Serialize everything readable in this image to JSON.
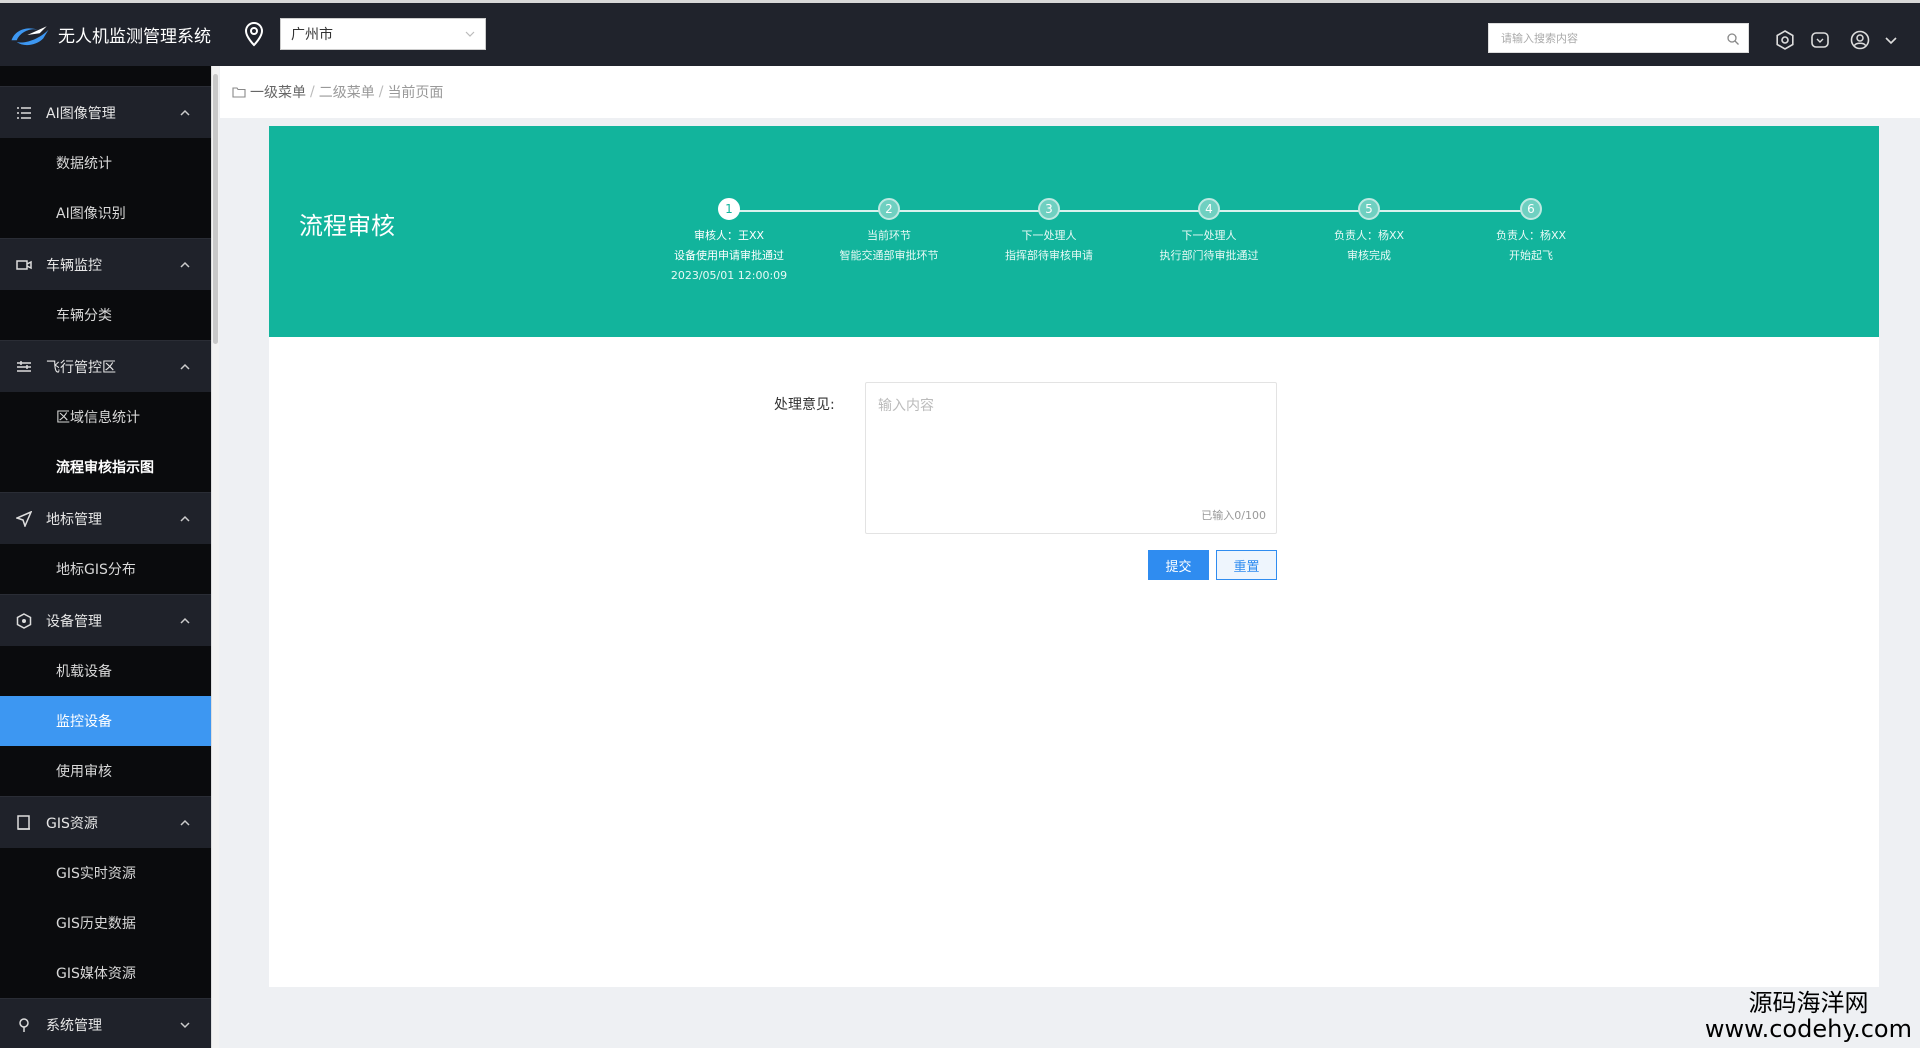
{
  "app": {
    "title": "无人机监测管理系统"
  },
  "header": {
    "city": "广州市",
    "search_placeholder": "请输入搜索内容",
    "icons": [
      "settings-icon",
      "message-icon",
      "user-icon",
      "chevron-down-icon"
    ]
  },
  "sidebar": {
    "groups": [
      {
        "label": "AI图像管理",
        "icon": "list-icon",
        "items": [
          {
            "label": "数据统计"
          },
          {
            "label": "AI图像识别"
          }
        ]
      },
      {
        "label": "车辆监控",
        "icon": "camera-icon",
        "items": [
          {
            "label": "车辆分类"
          }
        ]
      },
      {
        "label": "飞行管控区",
        "icon": "sliders-icon",
        "items": [
          {
            "label": "区域信息统计"
          },
          {
            "label": "流程审核指示图"
          }
        ]
      },
      {
        "label": "地标管理",
        "icon": "navigation-icon",
        "items": [
          {
            "label": "地标GIS分布"
          }
        ]
      },
      {
        "label": "设备管理",
        "icon": "device-icon",
        "items": [
          {
            "label": "机载设备"
          },
          {
            "label": "监控设备"
          },
          {
            "label": "使用审核"
          }
        ]
      },
      {
        "label": "GIS资源",
        "icon": "book-icon",
        "items": [
          {
            "label": "GIS实时资源"
          },
          {
            "label": "GIS历史数据"
          },
          {
            "label": "GIS媒体资源"
          }
        ]
      },
      {
        "label": "系统管理",
        "icon": "location-icon",
        "items": []
      }
    ],
    "active_item": "监控设备"
  },
  "breadcrumb": {
    "level1": "一级菜单",
    "level2": "二级菜单",
    "current": "当前页面"
  },
  "process": {
    "title": "流程审核",
    "steps": [
      {
        "num": "1",
        "line1": "审核人：王XX",
        "line2": "设备使用申请审批通过",
        "line3": "2023/05/01  12:00:09",
        "done": true
      },
      {
        "num": "2",
        "line1": "当前环节",
        "line2": "智能交通部审批环节",
        "line3": ""
      },
      {
        "num": "3",
        "line1": "下一处理人",
        "line2": "指挥部待审核申请",
        "line3": ""
      },
      {
        "num": "4",
        "line1": "下一处理人",
        "line2": "执行部门待审批通过",
        "line3": ""
      },
      {
        "num": "5",
        "line1": "负责人：杨XX",
        "line2": "审核完成",
        "line3": ""
      },
      {
        "num": "6",
        "line1": "负责人：杨XX",
        "line2": "开始起飞",
        "line3": ""
      }
    ]
  },
  "form": {
    "label": "处理意见:",
    "placeholder": "输入内容",
    "counter": "已输入0/100",
    "submit": "提交",
    "reset": "重置"
  },
  "watermark": {
    "line1": "源码海洋网",
    "line2": "www.codehy.com"
  }
}
